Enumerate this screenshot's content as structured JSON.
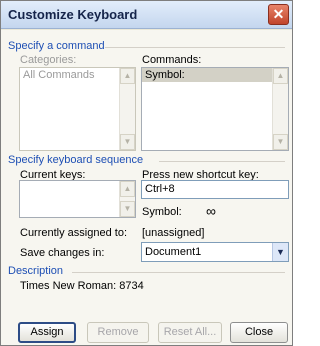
{
  "window": {
    "title": "Customize Keyboard",
    "close_glyph": "✕"
  },
  "command_section": {
    "heading": "Specify a command",
    "categories_label": "Categories:",
    "commands_label": "Commands:"
  },
  "categories": {
    "items": [
      "All Commands"
    ]
  },
  "commands": {
    "items": [
      "Symbol:"
    ]
  },
  "keyseq_section": {
    "heading": "Specify keyboard sequence",
    "current_keys_label": "Current keys:",
    "press_new_label": "Press new shortcut key:",
    "shortcut_value": "Ctrl+8",
    "symbol_label": "Symbol:",
    "symbol_glyph": "∞",
    "assigned_label": "Currently assigned to:",
    "assigned_value": "[unassigned]",
    "save_label": "Save changes in:",
    "save_value": "Document1"
  },
  "description": {
    "heading": "Description",
    "text": "Times New Roman: 8734"
  },
  "buttons": {
    "assign": "Assign",
    "remove": "Remove",
    "reset_all": "Reset All...",
    "close": "Close"
  }
}
